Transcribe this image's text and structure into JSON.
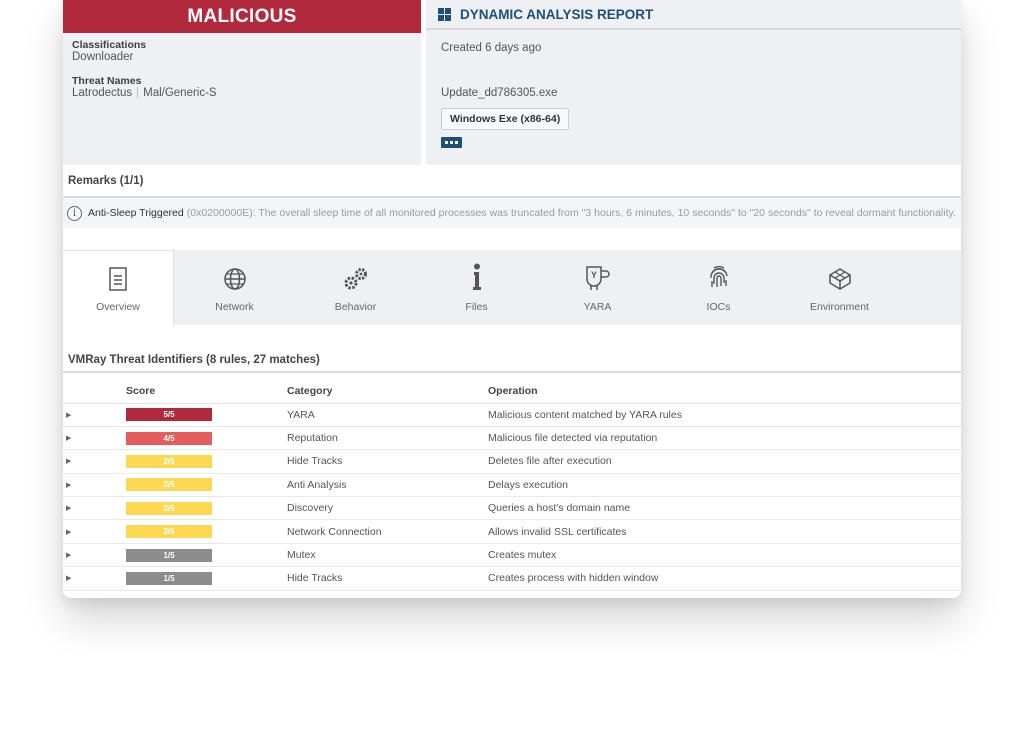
{
  "verdict": {
    "label": "MALICIOUS",
    "color": "#b12a3c"
  },
  "left": {
    "classifications_label": "Classifications",
    "classifications_value": "Downloader",
    "threat_names_label": "Threat Names",
    "threat_names": [
      "Latrodectus",
      "Mal/Generic-S"
    ]
  },
  "report": {
    "icon": "windows-icon",
    "title": "DYNAMIC ANALYSIS REPORT",
    "created": "Created 6 days ago",
    "filename": "Update_dd786305.exe",
    "file_type": "Windows Exe (x86-64)",
    "more_icon": "ellipsis-icon"
  },
  "remarks": {
    "title": "Remarks (1/1)",
    "item_title": "Anti-Sleep Triggered",
    "item_text": "(0x0200000E): The overall sleep time of all monitored processes was truncated from \"3 hours, 6 minutes, 10 seconds\" to \"20 seconds\" to reveal dormant functionality."
  },
  "tabs": [
    {
      "label": "Overview",
      "icon": "document-icon",
      "active": true
    },
    {
      "label": "Network",
      "icon": "globe-icon",
      "active": false
    },
    {
      "label": "Behavior",
      "icon": "gears-icon",
      "active": false
    },
    {
      "label": "Files",
      "icon": "info-icon",
      "active": false
    },
    {
      "label": "YARA",
      "icon": "yara-icon",
      "active": false
    },
    {
      "label": "IOCs",
      "icon": "fingerprint-icon",
      "active": false
    },
    {
      "label": "Environment",
      "icon": "cube-icon",
      "active": false
    }
  ],
  "vti": {
    "title": "VMRay Threat Identifiers (8 rules, 27 matches)",
    "columns": [
      "Score",
      "Category",
      "Operation"
    ],
    "rows": [
      {
        "score": "5/5",
        "color": "#b12a3c",
        "category": "YARA",
        "operation": "Malicious content matched by YARA rules"
      },
      {
        "score": "4/5",
        "color": "#e35d5d",
        "category": "Reputation",
        "operation": "Malicious file detected via reputation"
      },
      {
        "score": "2/5",
        "color": "#fdd853",
        "category": "Hide Tracks",
        "operation": "Deletes file after execution"
      },
      {
        "score": "2/5",
        "color": "#fdd853",
        "category": "Anti Analysis",
        "operation": "Delays execution"
      },
      {
        "score": "2/5",
        "color": "#fdd853",
        "category": "Discovery",
        "operation": "Queries a host's domain name"
      },
      {
        "score": "2/5",
        "color": "#fdd853",
        "category": "Network Connection",
        "operation": "Allows invalid SSL certificates"
      },
      {
        "score": "1/5",
        "color": "#8c8c8c",
        "category": "Mutex",
        "operation": "Creates mutex"
      },
      {
        "score": "1/5",
        "color": "#8c8c8c",
        "category": "Hide Tracks",
        "operation": "Creates process with hidden window"
      }
    ]
  }
}
